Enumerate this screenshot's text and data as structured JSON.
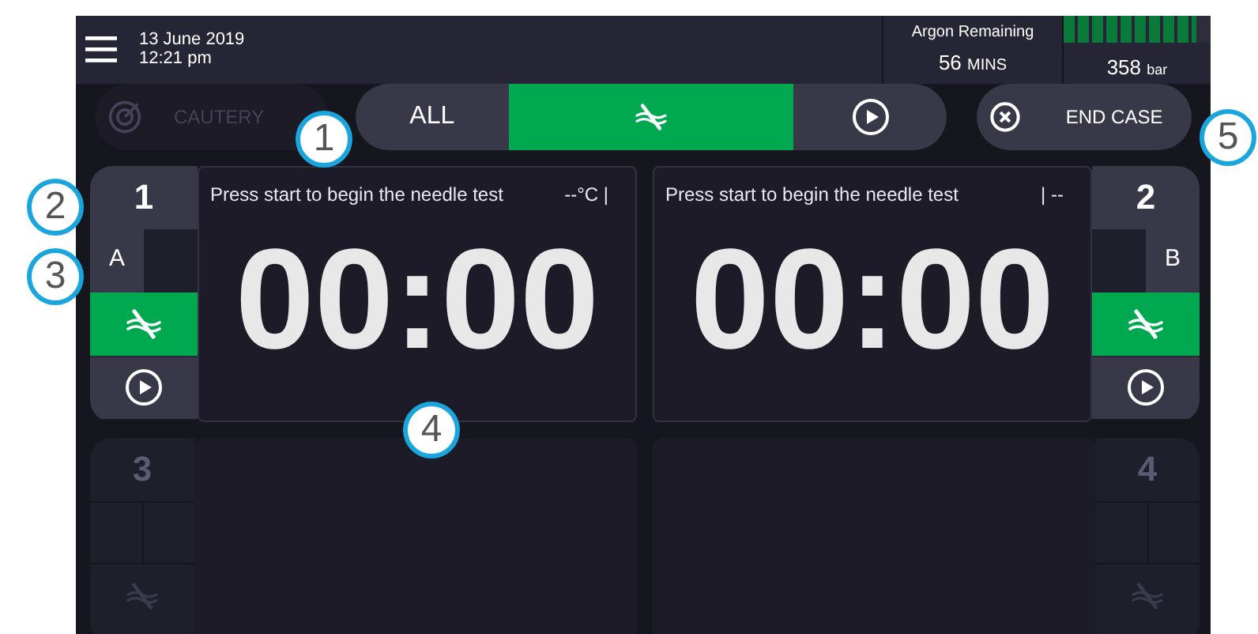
{
  "header": {
    "date": "13 June 2019",
    "time": "12:21 pm",
    "argon": {
      "label": "Argon Remaining",
      "minutes": "56",
      "minutes_unit": "MINS",
      "pressure": "358",
      "pressure_unit": "bar",
      "level": 0.9
    }
  },
  "toolbar": {
    "cautery": {
      "label": "CAUTERY",
      "disabled": true
    },
    "modes": [
      {
        "kind": "text",
        "label": "ALL",
        "selected": false
      },
      {
        "kind": "needle",
        "selected": true
      },
      {
        "kind": "play",
        "selected": false
      }
    ],
    "end_case": {
      "label": "END CASE"
    }
  },
  "channels": [
    {
      "number": "1",
      "enabled": true,
      "letter": "A",
      "mode_active": true,
      "message": "Press start to begin the needle test",
      "temperature": "--°C |",
      "timer": "00:00"
    },
    {
      "number": "2",
      "enabled": true,
      "letter": "B",
      "mode_active": true,
      "message": "Press start to begin the needle test",
      "temperature": "| --",
      "timer": "00:00"
    },
    {
      "number": "3",
      "enabled": false,
      "mode_active": false
    },
    {
      "number": "4",
      "enabled": false,
      "mode_active": false
    }
  ],
  "callouts": [
    "1",
    "2",
    "3",
    "4",
    "5"
  ]
}
